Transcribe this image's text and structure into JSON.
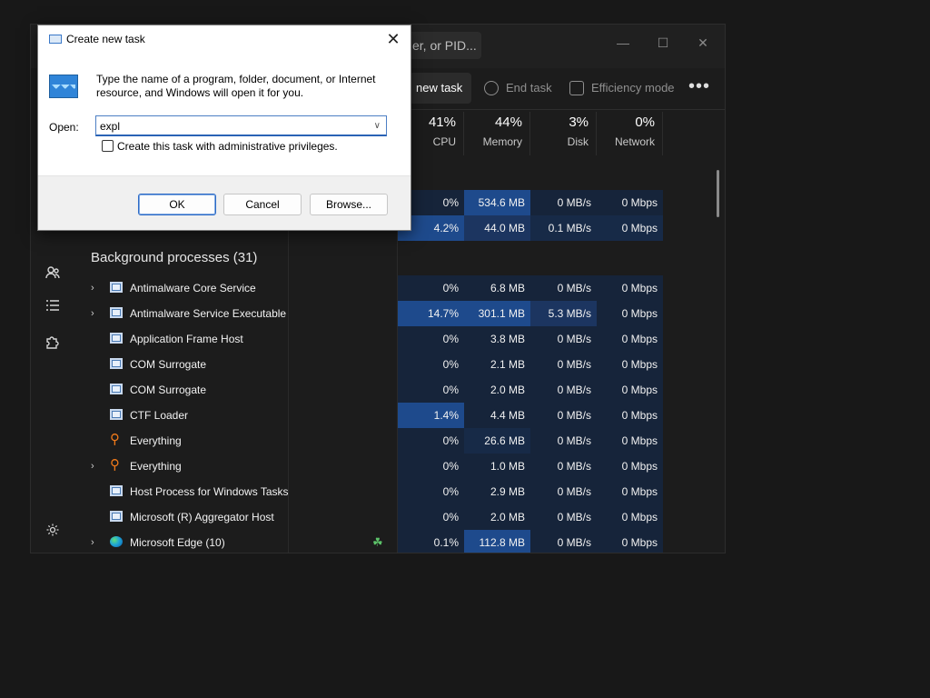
{
  "task_manager": {
    "search_placeholder": "er, or PID...",
    "window_controls": {
      "minimize": "—",
      "maximize": "☐",
      "close": "✕"
    },
    "toolbar": {
      "run_new_task": "new task",
      "end_task": "End task",
      "efficiency_mode": "Efficiency mode",
      "more": "•••"
    },
    "columns": [
      {
        "pct": "41%",
        "label": "CPU"
      },
      {
        "pct": "44%",
        "label": "Memory"
      },
      {
        "pct": "3%",
        "label": "Disk"
      },
      {
        "pct": "0%",
        "label": "Network"
      }
    ],
    "partial_rows": [
      {
        "name": "",
        "cpu": "0%",
        "memory": "534.6 MB",
        "disk": "0 MB/s",
        "network": "0 Mbps"
      },
      {
        "name": "",
        "cpu": "4.2%",
        "memory": "44.0 MB",
        "disk": "0.1 MB/s",
        "network": "0 Mbps"
      }
    ],
    "section_title": "Background processes (31)",
    "processes": [
      {
        "name": "Antimalware Core Service",
        "expand": "›",
        "icon": "window-icon",
        "cpu": "0%",
        "memory": "6.8 MB",
        "disk": "0 MB/s",
        "network": "0 Mbps"
      },
      {
        "name": "Antimalware Service Executable",
        "expand": "›",
        "icon": "window-icon",
        "cpu": "14.7%",
        "memory": "301.1 MB",
        "disk": "5.3 MB/s",
        "network": "0 Mbps"
      },
      {
        "name": "Application Frame Host",
        "expand": "",
        "icon": "window-icon",
        "cpu": "0%",
        "memory": "3.8 MB",
        "disk": "0 MB/s",
        "network": "0 Mbps"
      },
      {
        "name": "COM Surrogate",
        "expand": "",
        "icon": "window-icon",
        "cpu": "0%",
        "memory": "2.1 MB",
        "disk": "0 MB/s",
        "network": "0 Mbps"
      },
      {
        "name": "COM Surrogate",
        "expand": "",
        "icon": "window-icon",
        "cpu": "0%",
        "memory": "2.0 MB",
        "disk": "0 MB/s",
        "network": "0 Mbps"
      },
      {
        "name": "CTF Loader",
        "expand": "",
        "icon": "window-icon",
        "cpu": "1.4%",
        "memory": "4.4 MB",
        "disk": "0 MB/s",
        "network": "0 Mbps"
      },
      {
        "name": "Everything",
        "expand": "",
        "icon": "search-icon",
        "cpu": "0%",
        "memory": "26.6 MB",
        "disk": "0 MB/s",
        "network": "0 Mbps"
      },
      {
        "name": "Everything",
        "expand": "›",
        "icon": "search-icon",
        "cpu": "0%",
        "memory": "1.0 MB",
        "disk": "0 MB/s",
        "network": "0 Mbps"
      },
      {
        "name": "Host Process for Windows Tasks",
        "expand": "",
        "icon": "window-icon",
        "cpu": "0%",
        "memory": "2.9 MB",
        "disk": "0 MB/s",
        "network": "0 Mbps"
      },
      {
        "name": "Microsoft (R) Aggregator Host",
        "expand": "",
        "icon": "window-icon",
        "cpu": "0%",
        "memory": "2.0 MB",
        "disk": "0 MB/s",
        "network": "0 Mbps"
      },
      {
        "name": "Microsoft Edge (10)",
        "expand": "›",
        "icon": "edge-icon",
        "cpu": "0.1%",
        "memory": "112.8 MB",
        "disk": "0 MB/s",
        "network": "0 Mbps"
      }
    ]
  },
  "dialog": {
    "title": "Create new task",
    "close": "✕",
    "description": "Type the name of a program, folder, document, or Internet resource, and Windows will open it for you.",
    "open_label": "Open:",
    "open_value": "expl",
    "admin_checkbox_label": "Create this task with administrative privileges.",
    "ok": "OK",
    "cancel": "Cancel",
    "browse": "Browse..."
  },
  "colors": {
    "heat_low": "#172a47",
    "heat_mid": "#1c3560",
    "heat_high": "#1e4a8c",
    "accent": "#2c6bc7"
  }
}
